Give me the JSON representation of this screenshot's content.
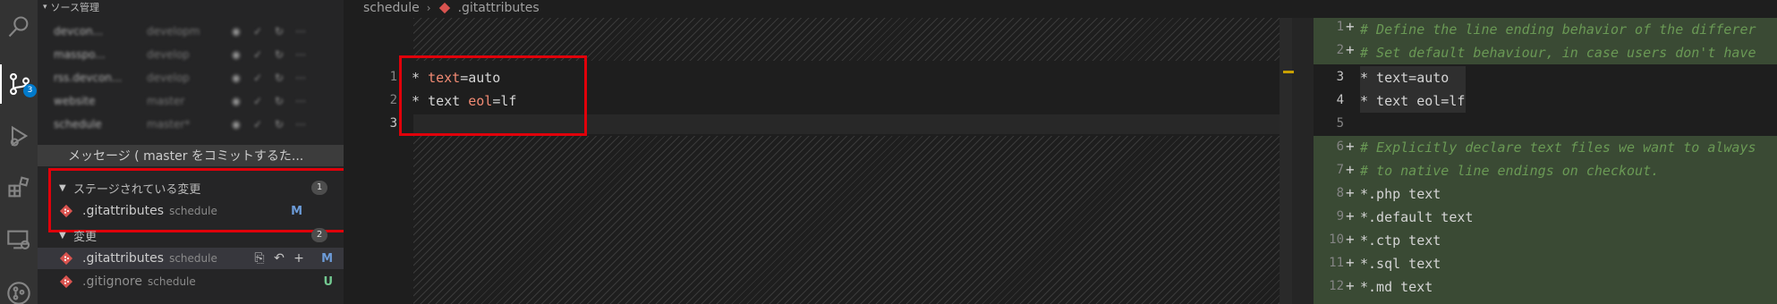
{
  "sidebar": {
    "title": "ソース管理",
    "repos": [
      {
        "name": "devcon...",
        "branch": "developm"
      },
      {
        "name": "masspo...",
        "branch": "develop"
      },
      {
        "name": "rss.devcon...",
        "branch": "develop"
      },
      {
        "name": "website",
        "branch": "master"
      },
      {
        "name": "schedule",
        "branch": "master*"
      }
    ],
    "commit_placeholder": "メッセージ ( master  をコミットするた...",
    "staged": {
      "header": "ステージされている変更",
      "count": "1",
      "files": [
        {
          "name": ".gitattributes",
          "dir": "schedule",
          "status": "M"
        }
      ]
    },
    "changes": {
      "header": "変更",
      "count": "2",
      "files": [
        {
          "name": ".gitattributes",
          "dir": "schedule",
          "status": "M"
        },
        {
          "name": ".gitignore",
          "dir": "schedule",
          "status": "U"
        }
      ]
    },
    "scm_badge": "3"
  },
  "breadcrumb": {
    "folder": "schedule",
    "file": ".gitattributes"
  },
  "left_editor": {
    "lines": [
      {
        "num": "1",
        "star": "*",
        "key": "text",
        "eq": "=",
        "val": "auto"
      },
      {
        "num": "2",
        "star": "*",
        "key": "text",
        "key2": "eol",
        "eq": "=",
        "val": "lf"
      },
      {
        "num": "3"
      }
    ]
  },
  "right_editor": {
    "lines": [
      {
        "num": "1",
        "comment": "# Define the line ending behavior of the differer"
      },
      {
        "num": "2",
        "comment": "# Set default behaviour, in case users don't have"
      },
      {
        "num": "3",
        "code": "* text=auto"
      },
      {
        "num": "4",
        "code": "* text eol=lf"
      },
      {
        "num": "5",
        "code": ""
      },
      {
        "num": "6",
        "comment": "# Explicitly declare text files we want to always"
      },
      {
        "num": "7",
        "comment": "# to native line endings on checkout."
      },
      {
        "num": "8",
        "code": "*.php text"
      },
      {
        "num": "9",
        "code": "*.default text"
      },
      {
        "num": "10",
        "code": "*.ctp text"
      },
      {
        "num": "11",
        "code": "*.sql text"
      },
      {
        "num": "12",
        "code": "*.md text"
      }
    ]
  },
  "colors": {
    "accent": "#007acc",
    "highlight_box": "#e0000a",
    "insert_bg": "#3a4a34"
  }
}
